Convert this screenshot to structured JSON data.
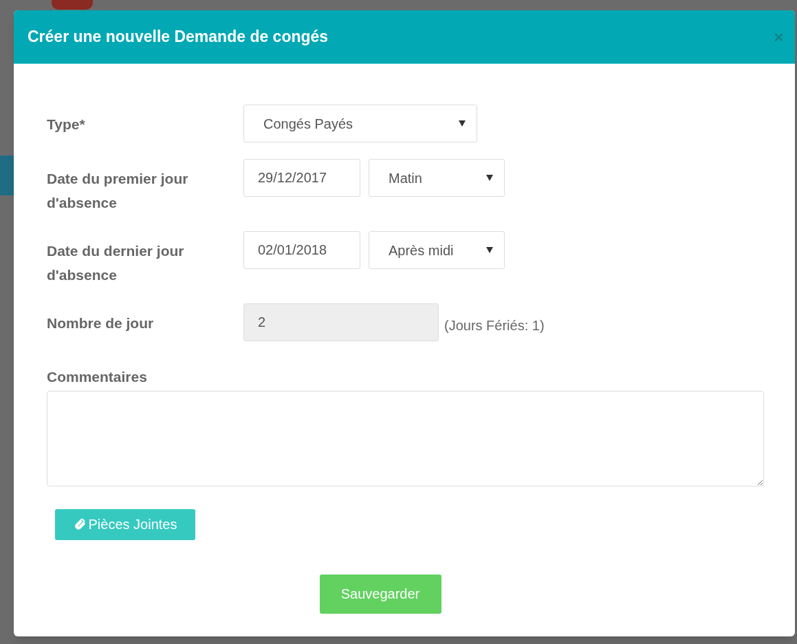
{
  "dialog": {
    "title": "Créer une nouvelle Demande de congés",
    "close": "×"
  },
  "form": {
    "fields": [
      {
        "kind": "select",
        "label": "Type*",
        "value": "Congés Payés"
      },
      {
        "kind": "date_half",
        "label": "Date du premier jour d'absence",
        "date": "29/12/2017",
        "half": "Matin"
      },
      {
        "kind": "date_half",
        "label": "Date du dernier jour d'absence",
        "date": "02/01/2018",
        "half": "Après midi"
      },
      {
        "kind": "readonly",
        "label": "Nombre de jour",
        "value": "2",
        "note": "(Jours Fériés: 1)"
      }
    ],
    "comments": {
      "label": "Commentaires"
    },
    "attachments_button": "Pièces Jointes",
    "save_button": "Sauvegarder"
  }
}
